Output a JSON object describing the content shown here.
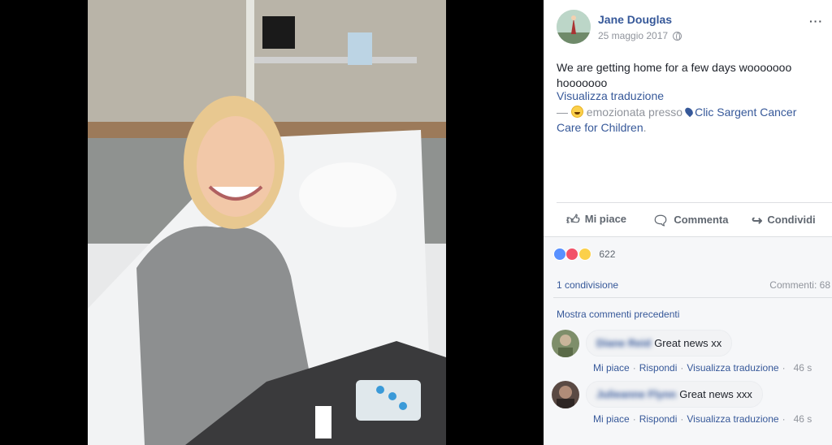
{
  "post": {
    "author": "Jane Douglas",
    "date": "25 maggio 2017",
    "menu": "···",
    "text": "We are getting home for a few days wooooooo hooooooo",
    "see_translation": "Visualizza traduzione",
    "feeling_prefix": "— ",
    "feeling_text": "emozionata presso",
    "place": "Clic Sargent Cancer Care for Children",
    "place_suffix": ".",
    "icons": [
      "globe-icon",
      "smile-emoji-icon",
      "location-pin-icon"
    ]
  },
  "actions": {
    "like": "Mi piace",
    "comment": "Commenta",
    "share": "Condividi"
  },
  "feedback": {
    "reaction_count": "622",
    "reactions": [
      "like",
      "love",
      "haha"
    ],
    "shares": "1 condivisione",
    "comments_count": "Commenti: 68",
    "more_comments": "Mostra commenti precedenti"
  },
  "comments": [
    {
      "name": "Diane Reid",
      "text": "Great news xx",
      "like": "Mi piace",
      "reply": "Rispondi",
      "translate": "Visualizza traduzione",
      "time": "46 s"
    },
    {
      "name": "Julieanne Flynn",
      "text": "Great news xxx",
      "like": "Mi piace",
      "reply": "Rispondi",
      "translate": "Visualizza traduzione",
      "time": "46 s"
    }
  ],
  "colors": {
    "link": "#365899",
    "muted": "#90949c",
    "text": "#1d2129",
    "viewer_bg": "#000000"
  }
}
